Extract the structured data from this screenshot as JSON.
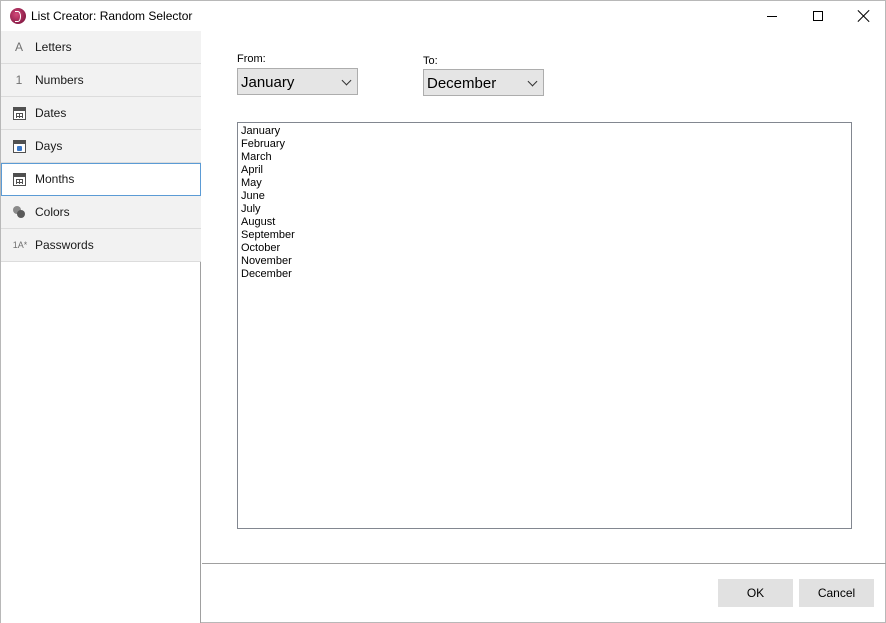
{
  "window": {
    "title": "List Creator: Random Selector"
  },
  "sidebar": {
    "items": [
      {
        "label": "Letters",
        "icon": "letter-a-icon",
        "glyph": "A"
      },
      {
        "label": "Numbers",
        "icon": "number-one-icon",
        "glyph": "1"
      },
      {
        "label": "Dates",
        "icon": "calendar-icon",
        "glyph": ""
      },
      {
        "label": "Days",
        "icon": "calendar-day-icon",
        "glyph": ""
      },
      {
        "label": "Months",
        "icon": "calendar-month-icon",
        "glyph": "",
        "selected": true
      },
      {
        "label": "Colors",
        "icon": "colors-icon",
        "glyph": ""
      },
      {
        "label": "Passwords",
        "icon": "password-icon",
        "glyph": "1A*"
      }
    ]
  },
  "main": {
    "from_label": "From:",
    "from_value": "January",
    "to_label": "To:",
    "to_value": "December",
    "list": [
      "January",
      "February",
      "March",
      "April",
      "May",
      "June",
      "July",
      "August",
      "September",
      "October",
      "November",
      "December"
    ]
  },
  "footer": {
    "ok_label": "OK",
    "cancel_label": "Cancel"
  },
  "colors": {
    "selection_border": "#5b9bd5",
    "app_icon": "#8c1d48"
  }
}
